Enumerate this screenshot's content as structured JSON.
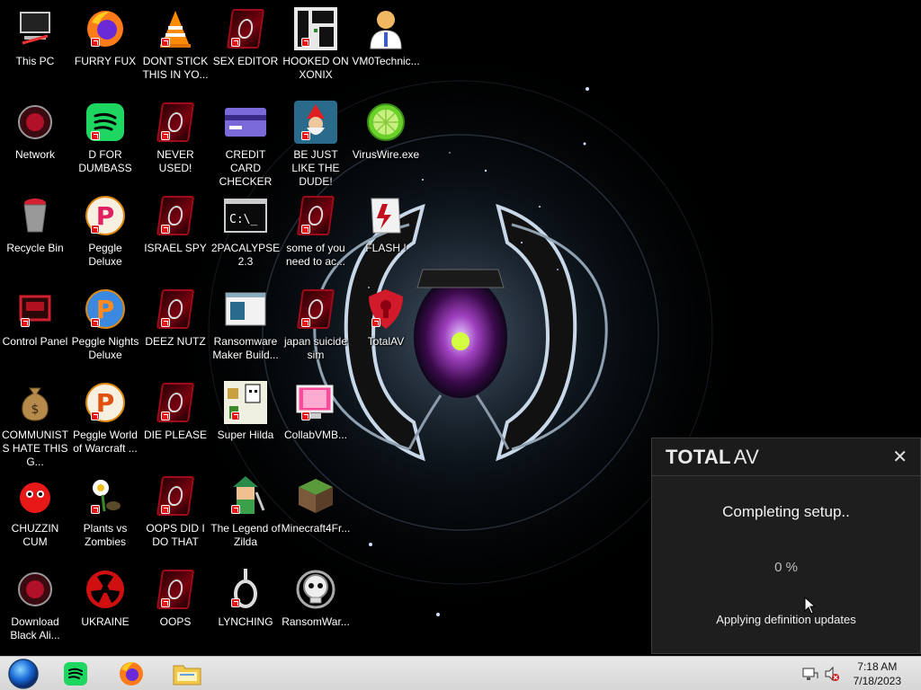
{
  "desktop": {
    "icons": [
      {
        "id": "this-pc",
        "label": "This PC",
        "icon": "computer-icon"
      },
      {
        "id": "network",
        "label": "Network",
        "icon": "network-icon"
      },
      {
        "id": "recycle-bin",
        "label": "Recycle Bin",
        "icon": "recycle-bin-icon"
      },
      {
        "id": "control-panel",
        "label": "Control Panel",
        "icon": "control-panel-icon"
      },
      {
        "id": "communists",
        "label": "COMMUNISTS HATE THIS G...",
        "icon": "money-bag-icon"
      },
      {
        "id": "chuzzin",
        "label": "CHUZZIN CUM",
        "icon": "chuzzle-icon"
      },
      {
        "id": "download-black",
        "label": "Download Black Ali...",
        "icon": "alienware-icon"
      },
      {
        "id": "furry-fux",
        "label": "FURRY FUX",
        "icon": "firefox-icon"
      },
      {
        "id": "d-for",
        "label": "D FOR DUMBASS",
        "icon": "spotify-icon"
      },
      {
        "id": "peggle-deluxe",
        "label": "Peggle Deluxe",
        "icon": "peggle-icon"
      },
      {
        "id": "peggle-nights",
        "label": "Peggle Nights Deluxe",
        "icon": "peggle-icon"
      },
      {
        "id": "peggle-world",
        "label": "Peggle World of Warcraft ...",
        "icon": "peggle-icon"
      },
      {
        "id": "plants-vs-zombies",
        "label": "Plants vs Zombies",
        "icon": "plant-icon"
      },
      {
        "id": "ukraine",
        "label": "UKRAINE",
        "icon": "radiation-icon"
      },
      {
        "id": "dont-stick",
        "label": "DONT STICK THIS IN YO...",
        "icon": "vlc-icon"
      },
      {
        "id": "never-used",
        "label": "NEVER USED!",
        "icon": "alien-icon"
      },
      {
        "id": "israel-spy",
        "label": "ISRAEL SPY",
        "icon": "alien-icon"
      },
      {
        "id": "deez-nutz",
        "label": "DEEZ NUTZ",
        "icon": "alien-icon"
      },
      {
        "id": "die-please",
        "label": "DIE PLEASE",
        "icon": "alien-icon"
      },
      {
        "id": "oops-did",
        "label": "OOPS DID I DO THAT",
        "icon": "alien-icon"
      },
      {
        "id": "oops",
        "label": "OOPS",
        "icon": "alien-icon"
      },
      {
        "id": "sex-editor",
        "label": "SEX EDITOR",
        "icon": "alien-icon"
      },
      {
        "id": "credit-card",
        "label": "CREDIT CARD CHECKER",
        "icon": "credit-card-icon"
      },
      {
        "id": "2pacalypse",
        "label": "2PACALYPSE 2.3",
        "icon": "terminal-icon"
      },
      {
        "id": "ransomware-maker",
        "label": "Ransomware Maker Build...",
        "icon": "window-icon"
      },
      {
        "id": "super-hilda",
        "label": "Super Hilda",
        "icon": "pixel-art-icon"
      },
      {
        "id": "legend-zilda",
        "label": "The Legend of Zilda",
        "icon": "link-character-icon"
      },
      {
        "id": "lynching",
        "label": "LYNCHING",
        "icon": "noose-icon"
      },
      {
        "id": "hooked-on",
        "label": "HOOKED ON XONIX",
        "icon": "xonix-icon"
      },
      {
        "id": "be-just-like",
        "label": "BE JUST LIKE THE DUDE!",
        "icon": "gnome-icon"
      },
      {
        "id": "some-of-you",
        "label": "some of you need to ac...",
        "icon": "alien-icon"
      },
      {
        "id": "japan-suicide",
        "label": "japan suicide sim",
        "icon": "alien-icon"
      },
      {
        "id": "collabvmb",
        "label": "CollabVMB...",
        "icon": "monitor-icon"
      },
      {
        "id": "minecraft4fr",
        "label": "Minecraft4Fr...",
        "icon": "grass-block-icon"
      },
      {
        "id": "ransomwar",
        "label": "RansomWar...",
        "icon": "skull-icon"
      },
      {
        "id": "vm0technic",
        "label": "VM0Technic...",
        "icon": "doctor-icon"
      },
      {
        "id": "viruswire",
        "label": "VirusWire.exe",
        "icon": "lime-icon"
      },
      {
        "id": "flash",
        "label": "FLASH !",
        "icon": "flash-icon"
      },
      {
        "id": "totalav",
        "label": "TotalAV",
        "icon": "shield-icon"
      }
    ]
  },
  "totalav_window": {
    "brand_bold": "TOTAL",
    "brand_light": "AV",
    "status": "Completing setup..",
    "progress_percent": 0,
    "progress_text": "0 %",
    "substatus": "Applying definition updates"
  },
  "taskbar": {
    "clock_time": "7:18 AM",
    "clock_date": "7/18/2023",
    "pinned": [
      "start-orb-icon",
      "spotify-icon",
      "firefox-icon",
      "file-explorer-icon"
    ],
    "tray": [
      "network-icon",
      "volume-muted-icon"
    ]
  },
  "colors": {
    "accent_red": "#d11a2a",
    "window_bg": "#1e1e1e",
    "taskbar_bg": "#dedede"
  }
}
